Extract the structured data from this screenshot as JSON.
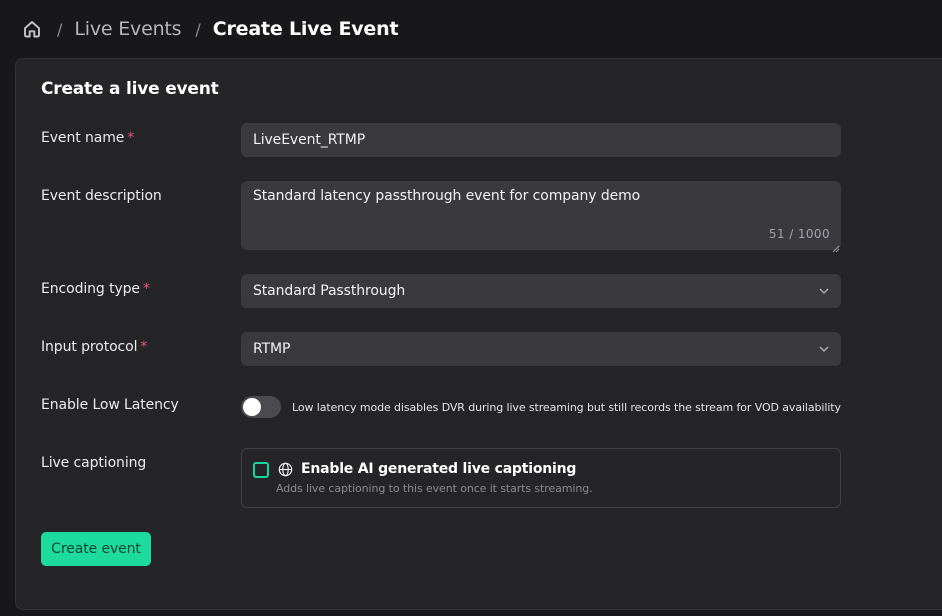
{
  "breadcrumb": {
    "home_icon": "home-icon",
    "separator": "/",
    "items": [
      "Live Events",
      "Create Live Event"
    ]
  },
  "form": {
    "title": "Create a live event",
    "required_marker": "*",
    "event_name": {
      "label": "Event name",
      "value": "LiveEvent_RTMP"
    },
    "event_description": {
      "label": "Event description",
      "value": "Standard latency passthrough event for company demo",
      "counter": "51 / 1000"
    },
    "encoding_type": {
      "label": "Encoding type",
      "value": "Standard Passthrough"
    },
    "input_protocol": {
      "label": "Input protocol",
      "value": "RTMP"
    },
    "low_latency": {
      "label": "Enable Low Latency",
      "enabled": false,
      "description": "Low latency mode disables DVR during live streaming but still records the stream for VOD availability"
    },
    "live_captioning": {
      "label": "Live captioning",
      "checked": false,
      "option_title": "Enable AI generated live captioning",
      "option_description": "Adds live captioning to this event once it starts streaming.",
      "icon": "globe-icon"
    },
    "submit_label": "Create event"
  },
  "colors": {
    "accent": "#1ddb9d",
    "required": "#f0506e",
    "background": "#18181a",
    "card": "#252528",
    "field": "#3a3a3e"
  }
}
